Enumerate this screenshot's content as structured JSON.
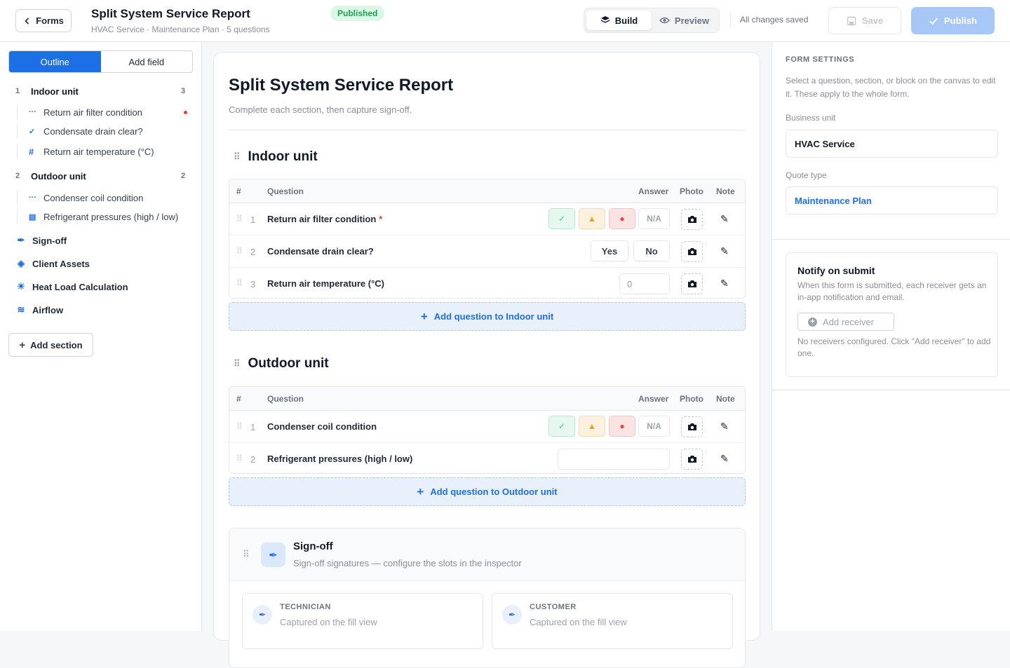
{
  "header": {
    "back_label": "Forms",
    "title": "Split System Service Report",
    "subtitle": "HVAC Service · Maintenance Plan · 5 questions",
    "status_badge": "Published",
    "modes": [
      {
        "label": "Build",
        "active": true
      },
      {
        "label": "Preview",
        "active": false
      }
    ],
    "save_status": "All changes saved",
    "save_label": "Save",
    "publish_label": "Publish"
  },
  "sidebar": {
    "tabs": [
      {
        "label": "Outline",
        "active": true
      },
      {
        "label": "Add field",
        "active": false
      }
    ],
    "sections": [
      {
        "num": "1",
        "name": "Indoor unit",
        "count": "3",
        "fields": [
          {
            "icon": "dots-icon",
            "name": "Return air filter condition",
            "required": true
          },
          {
            "icon": "check-icon",
            "name": "Condensate drain clear?",
            "required": false
          },
          {
            "icon": "hash-icon",
            "name": "Return air temperature (°C)",
            "required": false
          }
        ]
      },
      {
        "num": "2",
        "name": "Outdoor unit",
        "count": "2",
        "fields": [
          {
            "icon": "dots-icon",
            "name": "Condenser coil condition",
            "required": false
          },
          {
            "icon": "text-icon",
            "name": "Refrigerant pressures (high / low)",
            "required": false
          }
        ]
      }
    ],
    "blocks": [
      {
        "icon": "signature-icon",
        "name": "Sign-off"
      },
      {
        "icon": "cube-icon",
        "name": "Client Assets"
      },
      {
        "icon": "sun-icon",
        "name": "Heat Load Calculation"
      },
      {
        "icon": "wind-icon",
        "name": "Airflow"
      }
    ],
    "add_section_label": "Add section"
  },
  "canvas": {
    "title": "Split System Service Report",
    "subtitle": "Complete each section, then capture sign-off.",
    "columns": {
      "num": "#",
      "question": "Question",
      "answer": "Answer",
      "photo": "Photo",
      "note": "Note"
    },
    "sections": [
      {
        "name": "Indoor unit",
        "questions": [
          {
            "num": "1",
            "text": "Return air filter condition",
            "required": true,
            "type": "condition",
            "na_label": "N/A"
          },
          {
            "num": "2",
            "text": "Condensate drain clear?",
            "required": false,
            "type": "yesno",
            "yes_label": "Yes",
            "no_label": "No"
          },
          {
            "num": "3",
            "text": "Return air temperature (°C)",
            "required": false,
            "type": "number",
            "placeholder": "0"
          }
        ],
        "add_label": "Add question to Indoor unit"
      },
      {
        "name": "Outdoor unit",
        "questions": [
          {
            "num": "1",
            "text": "Condenser coil condition",
            "required": false,
            "type": "condition",
            "na_label": "N/A"
          },
          {
            "num": "2",
            "text": "Refrigerant pressures (high / low)",
            "required": false,
            "type": "text",
            "placeholder": ""
          }
        ],
        "add_label": "Add question to Outdoor unit"
      }
    ],
    "signoff": {
      "title": "Sign-off",
      "subtitle": "Sign-off signatures — configure the slots in the inspector",
      "slots": [
        {
          "label": "TECHNICIAN",
          "desc": "Captured on the fill view"
        },
        {
          "label": "CUSTOMER",
          "desc": "Captured on the fill view"
        }
      ]
    }
  },
  "inspector": {
    "heading": "FORM SETTINGS",
    "description": "Select a question, section, or block on the canvas to edit it. These apply to the whole form.",
    "business_unit_label": "Business unit",
    "business_unit_value": "HVAC Service",
    "quote_type_label": "Quote type",
    "quote_type_value": "Maintenance Plan",
    "notify": {
      "title": "Notify on submit",
      "description": "When this form is submitted, each receiver gets an in-app notification and email.",
      "add_label": "Add receiver",
      "empty_text": "No receivers configured. Click \"Add receiver\" to add one."
    }
  },
  "colors": {
    "accent": "#1d6fe6",
    "required": "#e53e3e",
    "published": "#16a34a"
  }
}
